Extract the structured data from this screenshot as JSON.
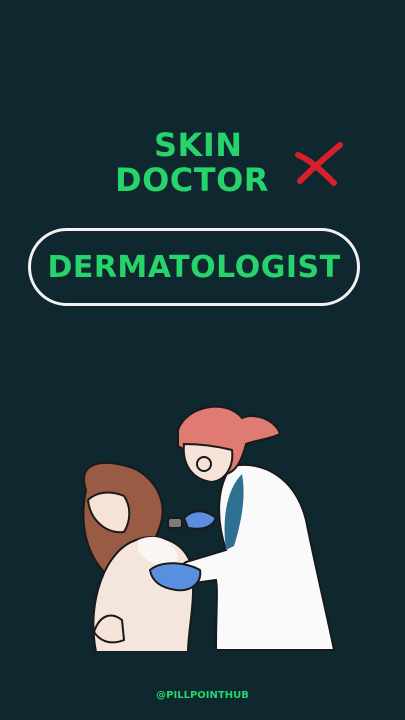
{
  "heading": {
    "line1": "SKIN",
    "line2": "DOCTOR",
    "status_icon": "cross-mark-icon",
    "status_color": "#d6202a"
  },
  "answer": {
    "label": "DERMATOLOGIST",
    "text_color": "#27d36b",
    "border_color": "#f2f2f2"
  },
  "illustration": {
    "subject": "doctor-examining-patient-illustration"
  },
  "footer": {
    "handle": "@PILLPOINTHUB"
  },
  "colors": {
    "background": "#0f2830",
    "accent_green": "#27d36b"
  }
}
